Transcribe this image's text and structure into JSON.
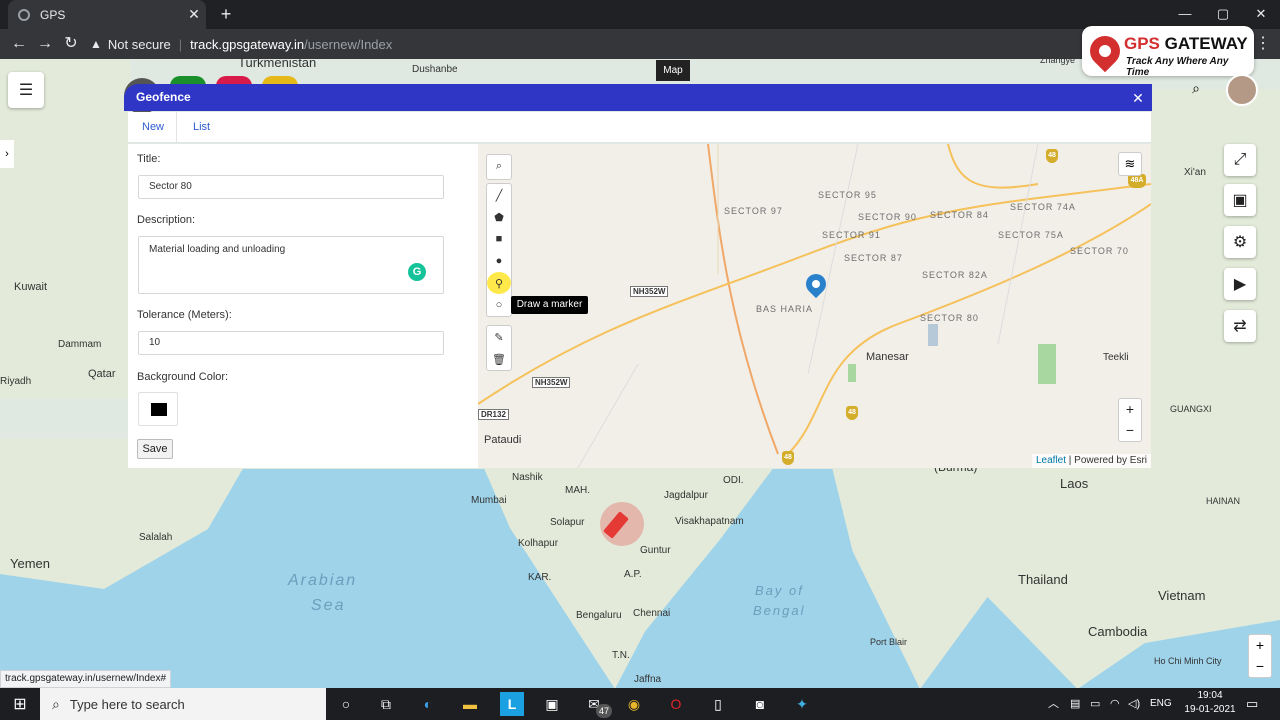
{
  "browser": {
    "tab_title": "GPS",
    "url_warning": "Not secure",
    "url_host": "track.gpsgateway.in",
    "url_path": "/usernew/Index",
    "status_url": "track.gpsgateway.in/usernew/Index#"
  },
  "logo": {
    "brand_gps": "GPS",
    "brand_gateway": " GATEWAY",
    "tagline": "Track Any Where Any Time"
  },
  "map_tab_label": "Map",
  "geofence": {
    "title": "Geofence",
    "tabs": [
      "New",
      "List"
    ],
    "form": {
      "title_label": "Title:",
      "title_value": "Sector 80",
      "description_label": "Description:",
      "description_value": "Material loading and unloading",
      "tolerance_label": "Tolerance (Meters):",
      "tolerance_value": "10",
      "bg_color_label": "Background Color:",
      "bg_color_value": "#000000",
      "save_label": "Save"
    },
    "draw_tooltip": "Draw a marker",
    "attribution_leaflet": "Leaflet",
    "attribution_rest": " | Powered by Esri",
    "zoom_in": "+",
    "zoom_out": "−"
  },
  "inner_map_labels": {
    "sectors": [
      "SECTOR 97",
      "SECTOR 95",
      "SECTOR 90",
      "SECTOR 84",
      "SECTOR 74A",
      "SECTOR 91",
      "SECTOR 75A",
      "SECTOR 87",
      "SECTOR 70",
      "SECTOR 82A",
      "BAS HARIA",
      "SECTOR 80"
    ],
    "places": [
      "Manesar",
      "Teekli",
      "Pataudi"
    ],
    "highways": [
      "NH352W",
      "NH352W",
      "DR132"
    ],
    "nh_shields": [
      "48",
      "48",
      "48",
      "48A"
    ]
  },
  "bg_map_labels": [
    "Turkmenistan",
    "Dushanbe",
    "Kuwait",
    "Dammam",
    "Qatar",
    "Riyadh",
    "Yemen",
    "Salalah",
    "Arabian",
    "Sea",
    "Nashik",
    "Mumbai",
    "MAH.",
    "Jagdalpur",
    "ODI.",
    "Solapur",
    "Visakhapatnam",
    "Kolhapur",
    "Guntur",
    "A.P.",
    "KAR.",
    "Bay of",
    "Bengal",
    "Bengaluru",
    "Chennai",
    "T.N.",
    "Jaffna",
    "Laos",
    "Thailand",
    "Vietnam",
    "Cambodia",
    "Port Blair",
    "Ho Chi Minh City",
    "GUANGXI",
    "HAINAN",
    "(Burma)",
    "Zhangye",
    "Xi'an",
    "Teekli"
  ],
  "taskbar": {
    "search_placeholder": "Type here to search",
    "mail_badge": "47",
    "lang": "ENG",
    "time": "19:04",
    "date": "19-01-2021"
  }
}
